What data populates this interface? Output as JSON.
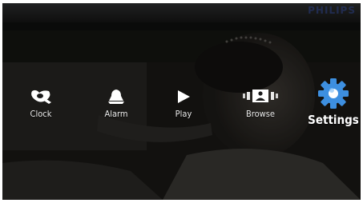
{
  "brand": "PHILIPS",
  "menu": {
    "items": [
      {
        "id": "clock",
        "label": "Clock",
        "icon": "clock-icon"
      },
      {
        "id": "alarm",
        "label": "Alarm",
        "icon": "alarm-bell-icon"
      },
      {
        "id": "play",
        "label": "Play",
        "icon": "play-icon"
      },
      {
        "id": "browse",
        "label": "Browse",
        "icon": "browse-photos-icon"
      },
      {
        "id": "settings",
        "label": "Settings",
        "icon": "gear-icon",
        "selected": true
      }
    ]
  },
  "colors": {
    "label": "#e9e9e9",
    "selected_icon": "#3d8fe0",
    "icon": "#ffffff",
    "brand": "#23305a"
  }
}
